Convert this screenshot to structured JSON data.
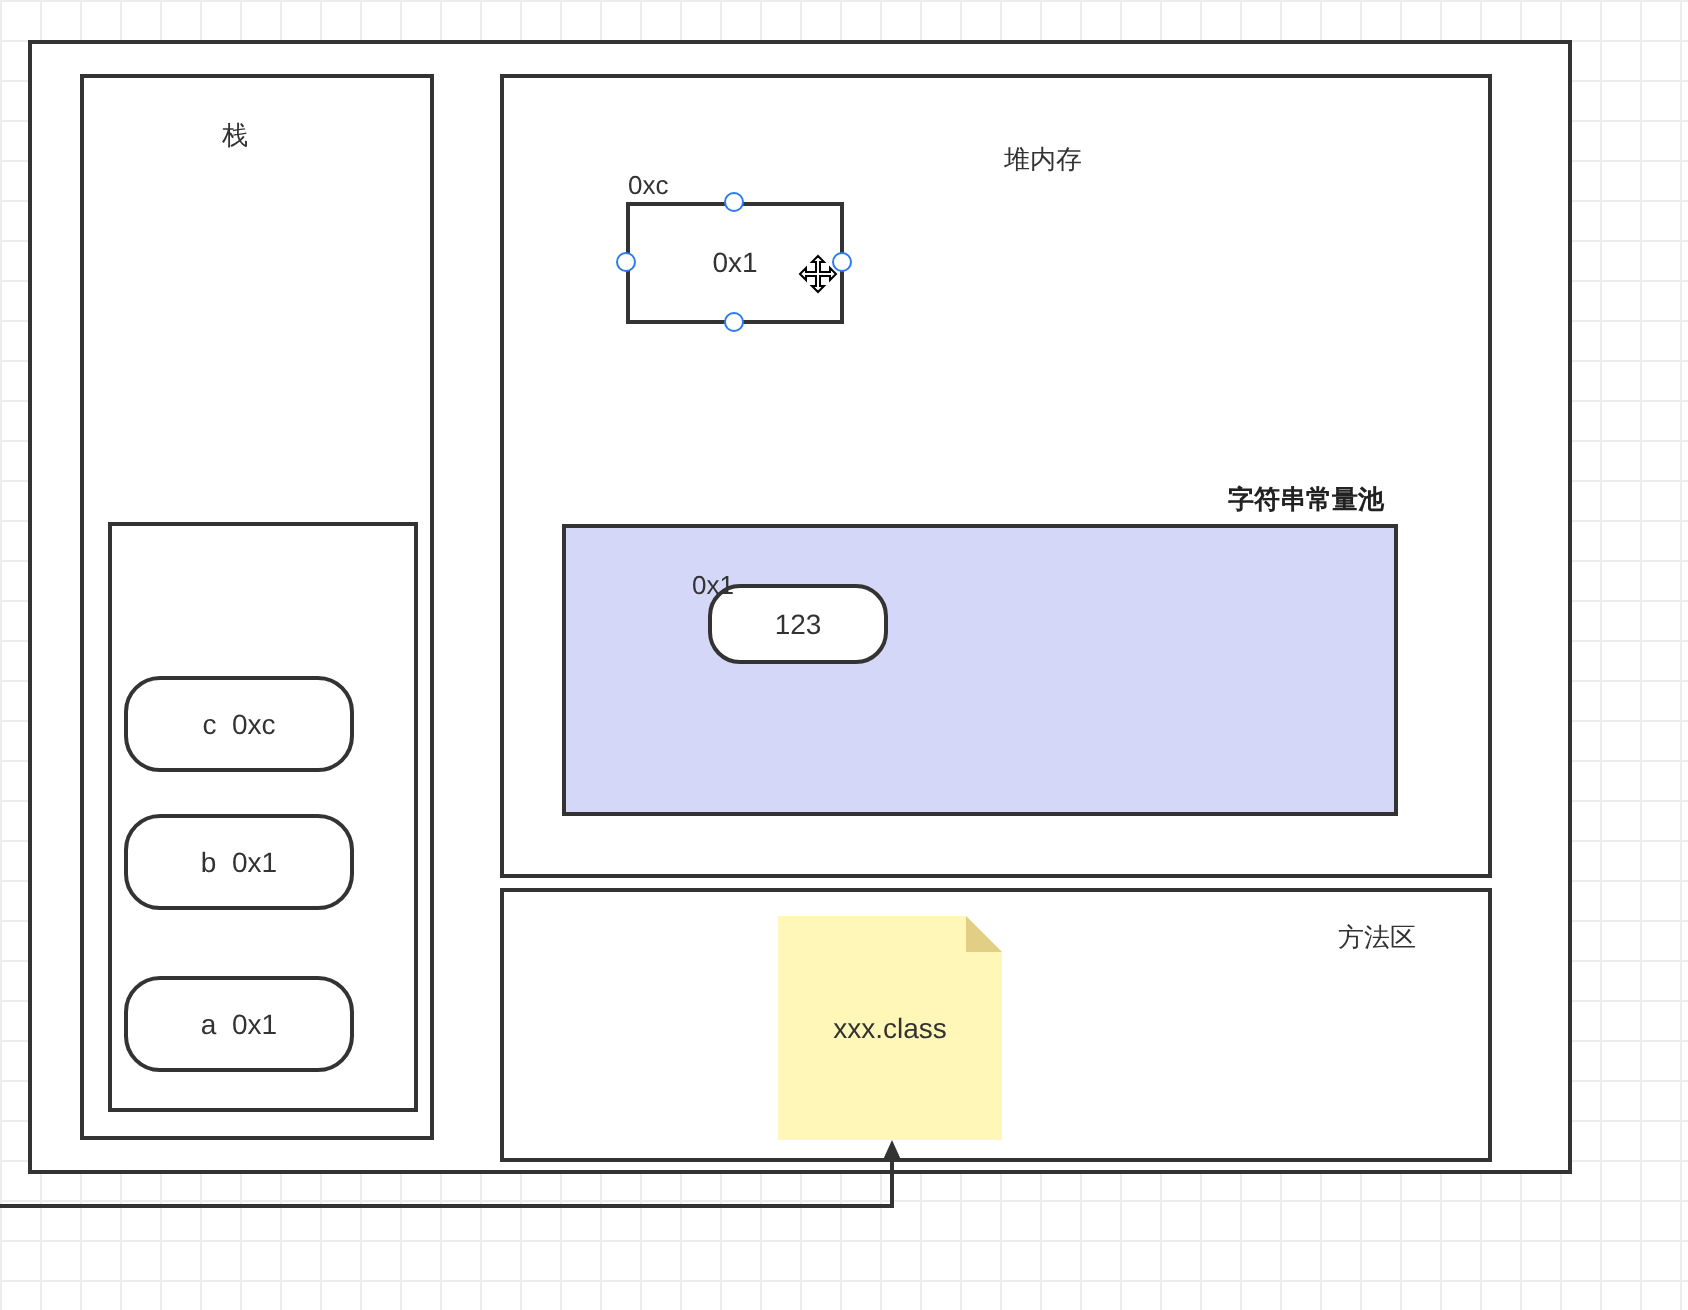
{
  "stack": {
    "label": "栈",
    "items": [
      {
        "text": "c  0xc"
      },
      {
        "text": "b  0x1"
      },
      {
        "text": "a  0x1"
      }
    ]
  },
  "heap": {
    "label": "堆内存",
    "object": {
      "address": "0xc",
      "value": "0x1",
      "selected": true
    },
    "string_pool": {
      "label": "字符串常量池",
      "entries": [
        {
          "address": "0x1",
          "value": "123"
        }
      ]
    }
  },
  "method_area": {
    "label": "方法区",
    "file": "xxx.class"
  }
}
